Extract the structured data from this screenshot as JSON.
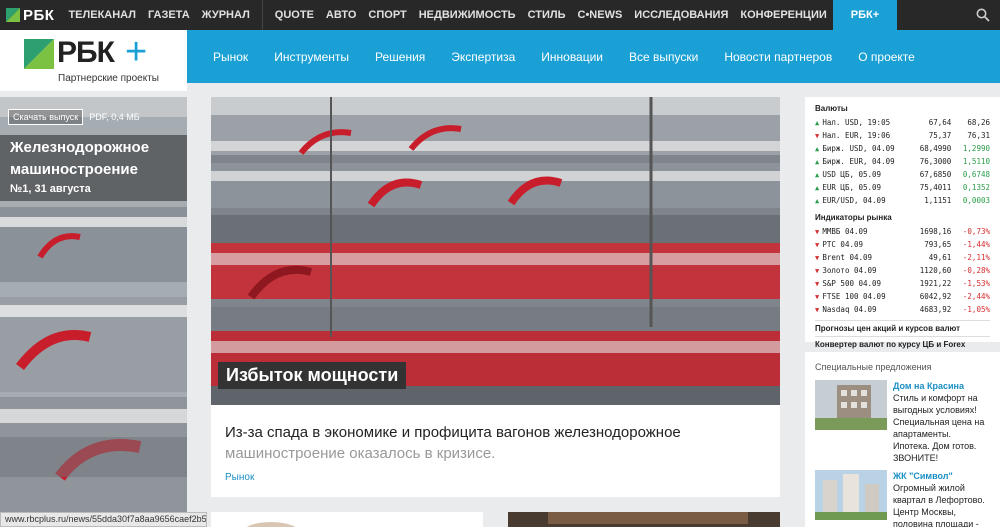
{
  "topbar": {
    "logo_text": "РБК",
    "left_nav": [
      "ТЕЛЕКАНАЛ",
      "ГАЗЕТА",
      "ЖУРНАЛ"
    ],
    "nav": [
      "QUOTE",
      "АВТО",
      "СПОРТ",
      "НЕДВИЖИМОСТЬ",
      "СТИЛЬ",
      "C•NEWS",
      "ИССЛЕДОВАНИЯ",
      "КОНФЕРЕНЦИИ"
    ],
    "active": "РБК+"
  },
  "header": {
    "brand": "РБК",
    "plus": "+",
    "subtitle": "Партнерские проекты",
    "nav": [
      "Рынок",
      "Инструменты",
      "Решения",
      "Экспертиза",
      "Инновации",
      "Все выпуски",
      "Новости партнеров",
      "О проекте"
    ]
  },
  "promo": {
    "download": "Скачать выпуск",
    "size": "PDF, 0,4 МБ",
    "title": "Железнодорожное машиностроение",
    "issue": "№1, 31 августа"
  },
  "article": {
    "headline": "Избыток мощности",
    "lead": "Из-за спада в экономике и профицита вагонов железнодорожное",
    "lead_fade": "машиностроение оказалось в кризисе.",
    "tag": "Рынок"
  },
  "rates": {
    "currency_title": "Валюты",
    "currencies": [
      {
        "dir": "up",
        "name": "Нал. USD, 19:05",
        "v1": "67,64",
        "v2": "68,26"
      },
      {
        "dir": "dn",
        "name": "Нал. EUR, 19:06",
        "v1": "75,37",
        "v2": "76,31"
      },
      {
        "dir": "up",
        "name": "Бирж. USD, 04.09",
        "v1": "68,4990",
        "v2": "1,2990"
      },
      {
        "dir": "up",
        "name": "Бирж. EUR, 04.09",
        "v1": "76,3000",
        "v2": "1,5110"
      },
      {
        "dir": "up",
        "name": "USD ЦБ, 05.09",
        "v1": "67,6850",
        "v2": "0,6748"
      },
      {
        "dir": "up",
        "name": "EUR ЦБ, 05.09",
        "v1": "75,4011",
        "v2": "0,1352"
      },
      {
        "dir": "up",
        "name": "EUR/USD, 04.09",
        "v1": "1,1151",
        "v2": "0,0003"
      }
    ],
    "index_title": "Индикаторы рынка",
    "indices": [
      {
        "dir": "dn",
        "name": "ММВБ 04.09",
        "v1": "1698,16",
        "v2": "-0,73%"
      },
      {
        "dir": "dn",
        "name": "РТС 04.09",
        "v1": "793,65",
        "v2": "-1,44%"
      },
      {
        "dir": "dn",
        "name": "Brent 04.09",
        "v1": "49,61",
        "v2": "-2,11%"
      },
      {
        "dir": "dn",
        "name": "Золото 04.09",
        "v1": "1120,60",
        "v2": "-0,28%"
      },
      {
        "dir": "dn",
        "name": "S&P 500 04.09",
        "v1": "1921,22",
        "v2": "-1,53%"
      },
      {
        "dir": "dn",
        "name": "FTSE 100 04.09",
        "v1": "6042,92",
        "v2": "-2,44%"
      },
      {
        "dir": "dn",
        "name": "Nasdaq 04.09",
        "v1": "4683,92",
        "v2": "-1,05%"
      }
    ],
    "link1": "Прогнозы цен акций и курсов валют",
    "link2": "Конвертер валют по курсу ЦБ и Forex"
  },
  "offers": {
    "title": "Специальные предложения",
    "items": [
      {
        "name": "Дом на Красина",
        "text": "Стиль и комфорт на выгодных условиях! Специальная цена на апартаменты. Ипотека. Дом готов. ЗВОНИТЕ!"
      },
      {
        "name": "ЖК \"Символ\"",
        "text": "Огромный жилой квартал в Лефортово. Центр Москвы, половина площади - парки и скверы."
      }
    ]
  },
  "status_url": "www.rbcplus.ru/news/55dda30f7a8aa9656caef2b5"
}
